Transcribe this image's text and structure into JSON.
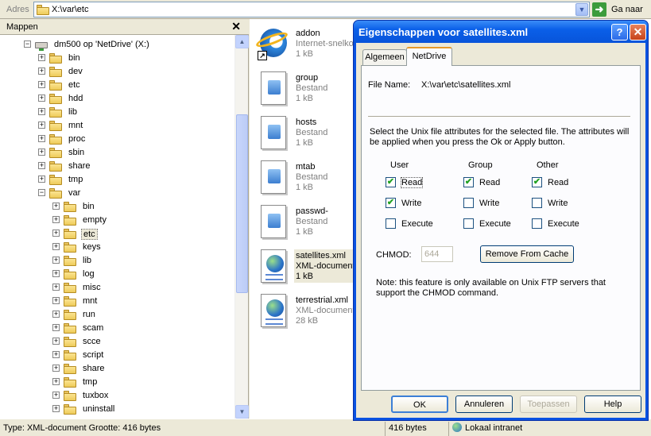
{
  "address": {
    "label": "Adres",
    "value": "X:\\var\\etc",
    "go_label": "Ga naar"
  },
  "folders": {
    "title": "Mappen",
    "close": "✕",
    "tree": [
      {
        "label": "dm500 op 'NetDrive' (X:)",
        "level": 0,
        "exp": "−",
        "icon": "network-drive"
      },
      {
        "label": "bin",
        "level": 1,
        "exp": "+"
      },
      {
        "label": "dev",
        "level": 1,
        "exp": "+"
      },
      {
        "label": "etc",
        "level": 1,
        "exp": "+"
      },
      {
        "label": "hdd",
        "level": 1,
        "exp": "+"
      },
      {
        "label": "lib",
        "level": 1,
        "exp": "+"
      },
      {
        "label": "mnt",
        "level": 1,
        "exp": "+"
      },
      {
        "label": "proc",
        "level": 1,
        "exp": "+"
      },
      {
        "label": "sbin",
        "level": 1,
        "exp": "+"
      },
      {
        "label": "share",
        "level": 1,
        "exp": "+"
      },
      {
        "label": "tmp",
        "level": 1,
        "exp": "+"
      },
      {
        "label": "var",
        "level": 1,
        "exp": "−"
      },
      {
        "label": "bin",
        "level": 2,
        "exp": "+"
      },
      {
        "label": "empty",
        "level": 2,
        "exp": "+"
      },
      {
        "label": "etc",
        "level": 2,
        "exp": "+",
        "selected": true
      },
      {
        "label": "keys",
        "level": 2,
        "exp": "+"
      },
      {
        "label": "lib",
        "level": 2,
        "exp": "+"
      },
      {
        "label": "log",
        "level": 2,
        "exp": "+"
      },
      {
        "label": "misc",
        "level": 2,
        "exp": "+"
      },
      {
        "label": "mnt",
        "level": 2,
        "exp": "+"
      },
      {
        "label": "run",
        "level": 2,
        "exp": "+"
      },
      {
        "label": "scam",
        "level": 2,
        "exp": "+"
      },
      {
        "label": "scce",
        "level": 2,
        "exp": "+"
      },
      {
        "label": "script",
        "level": 2,
        "exp": "+"
      },
      {
        "label": "share",
        "level": 2,
        "exp": "+"
      },
      {
        "label": "tmp",
        "level": 2,
        "exp": "+"
      },
      {
        "label": "tuxbox",
        "level": 2,
        "exp": "+"
      },
      {
        "label": "uninstall",
        "level": 2,
        "exp": "+"
      }
    ]
  },
  "files": [
    {
      "name": "addon",
      "type": "Internet-snelkoppeling",
      "size": "1 kB",
      "icon": "internet-shortcut-icon"
    },
    {
      "name": "group",
      "type": "Bestand",
      "size": "1 kB",
      "icon": "file-icon"
    },
    {
      "name": "hosts",
      "type": "Bestand",
      "size": "1 kB",
      "icon": "file-icon"
    },
    {
      "name": "mtab",
      "type": "Bestand",
      "size": "1 kB",
      "icon": "file-icon"
    },
    {
      "name": "passwd-",
      "type": "Bestand",
      "size": "1 kB",
      "icon": "file-icon"
    },
    {
      "name": "satellites.xml",
      "type": "XML-document",
      "size": "1 kB",
      "icon": "xml-document-icon",
      "selected": true
    },
    {
      "name": "terrestrial.xml",
      "type": "XML-document",
      "size": "28 kB",
      "icon": "xml-document-icon"
    }
  ],
  "status": {
    "left": "Type: XML-document Grootte: 416 bytes",
    "size": "416 bytes",
    "zone": "Lokaal intranet"
  },
  "dialog": {
    "title": "Eigenschappen voor satellites.xml",
    "help": "?",
    "close": "✕",
    "tabs": [
      "Algemeen",
      "NetDrive"
    ],
    "file_name_label": "File Name:",
    "file_name_value": "X:\\var\\etc\\satellites.xml",
    "description_line1": "Select the Unix file attributes for the selected file.  The attributes will",
    "description_line2": "be applied when you press the Ok or Apply button.",
    "groups": [
      "User",
      "Group",
      "Other"
    ],
    "perms": [
      "Read",
      "Write",
      "Execute"
    ],
    "checks": {
      "user": [
        true,
        true,
        false
      ],
      "group": [
        true,
        false,
        false
      ],
      "other": [
        true,
        false,
        false
      ]
    },
    "chmod_label": "CHMOD:",
    "chmod_value": "644",
    "remove_cache": "Remove From Cache",
    "note_line1": "Note: this feature is only available on Unix FTP servers that",
    "note_line2": "support the CHMOD command.",
    "buttons": {
      "ok": "OK",
      "cancel": "Annuleren",
      "apply": "Toepassen",
      "help": "Help"
    }
  },
  "colors": {
    "title_blue": "#0a5fe8",
    "selection": "#ece9d8",
    "check_green": "#21a121"
  }
}
